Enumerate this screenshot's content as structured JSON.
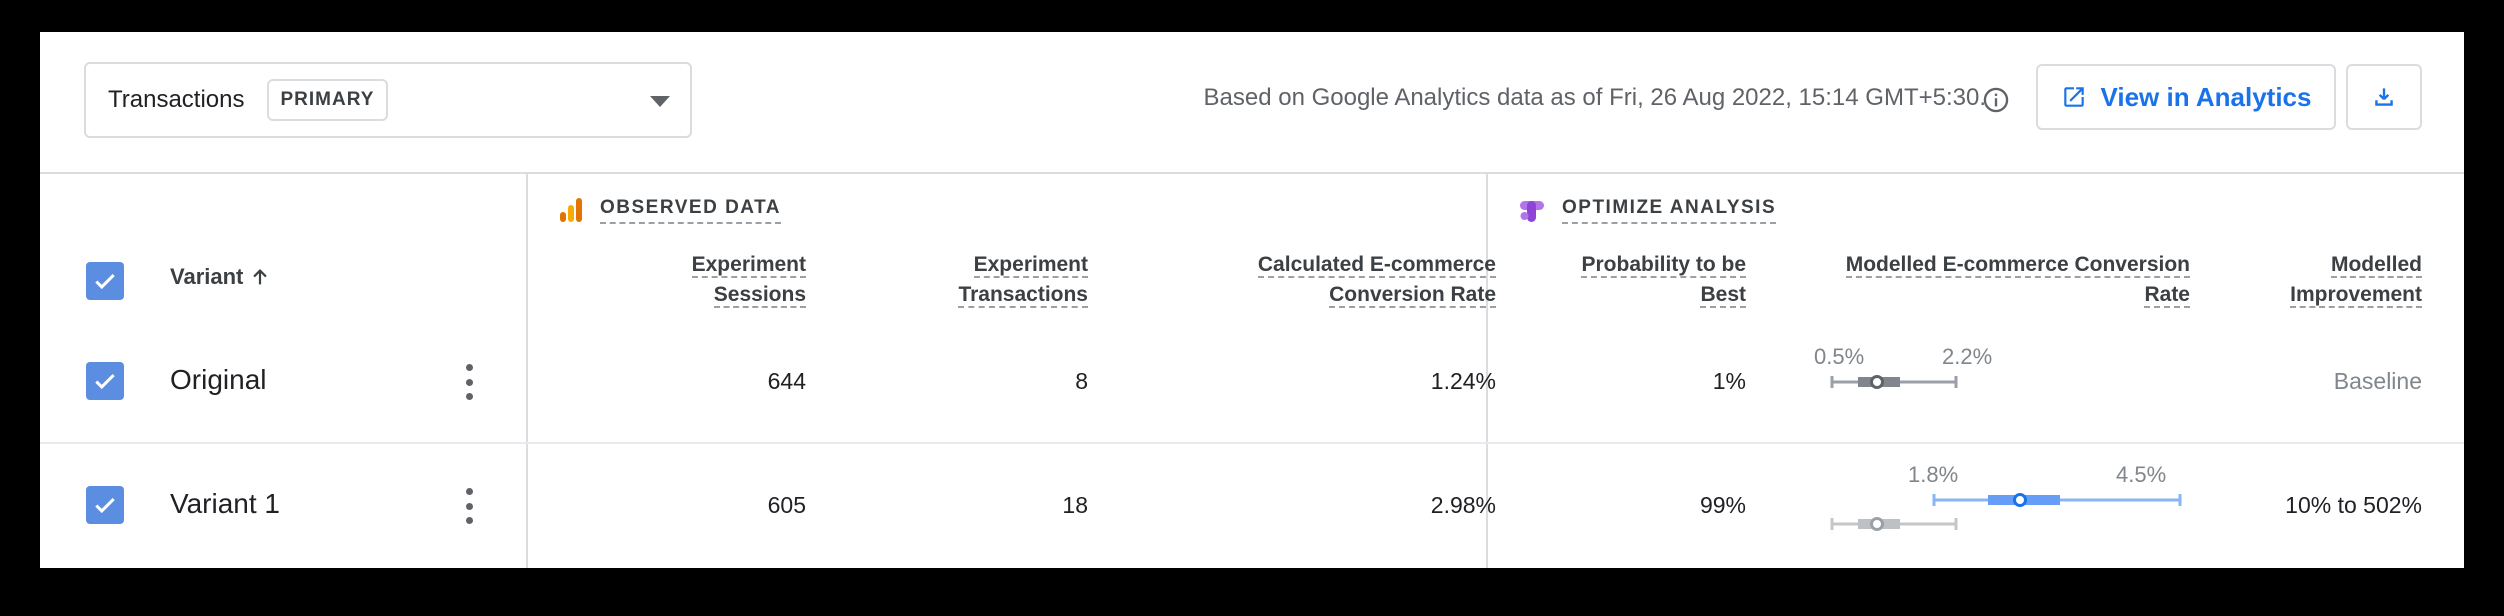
{
  "colors": {
    "accent": "#1a73e8",
    "checkbox": "#5b8de0",
    "ci_primary": "#8ab4f8",
    "ci_baseline": "#9aa0a6"
  },
  "header": {
    "metric": "Transactions",
    "badge": "PRIMARY",
    "data_note": "Based on Google Analytics data as of Fri, 26 Aug 2022, 15:14 GMT+5:30.",
    "view_button": "View in Analytics",
    "icons": [
      "chevron-down-icon",
      "info-icon",
      "open-external-icon",
      "download-icon"
    ]
  },
  "sections": {
    "observed": "OBSERVED DATA",
    "optimize": "OPTIMIZE ANALYSIS"
  },
  "columns": {
    "variant": "Variant",
    "sessions": [
      "Experiment",
      "Sessions"
    ],
    "transactions": [
      "Experiment",
      "Transactions"
    ],
    "conversion": [
      "Calculated E-commerce",
      "Conversion Rate"
    ],
    "probability": [
      "Probability to be",
      "Best"
    ],
    "modelled_rate": [
      "Modelled E-commerce Conversion",
      "Rate"
    ],
    "improvement": [
      "Modelled",
      "Improvement"
    ]
  },
  "rows": [
    {
      "name": "Original",
      "checked": true,
      "sessions": "644",
      "transactions": "8",
      "conversion": "1.24%",
      "probability": "1%",
      "ci_low_label": "0.5%",
      "ci_high_label": "2.2%",
      "improvement": "Baseline"
    },
    {
      "name": "Variant 1",
      "checked": true,
      "sessions": "605",
      "transactions": "18",
      "conversion": "2.98%",
      "probability": "99%",
      "ci_low_label": "1.8%",
      "ci_high_label": "4.5%",
      "improvement": "10% to 502%"
    }
  ]
}
